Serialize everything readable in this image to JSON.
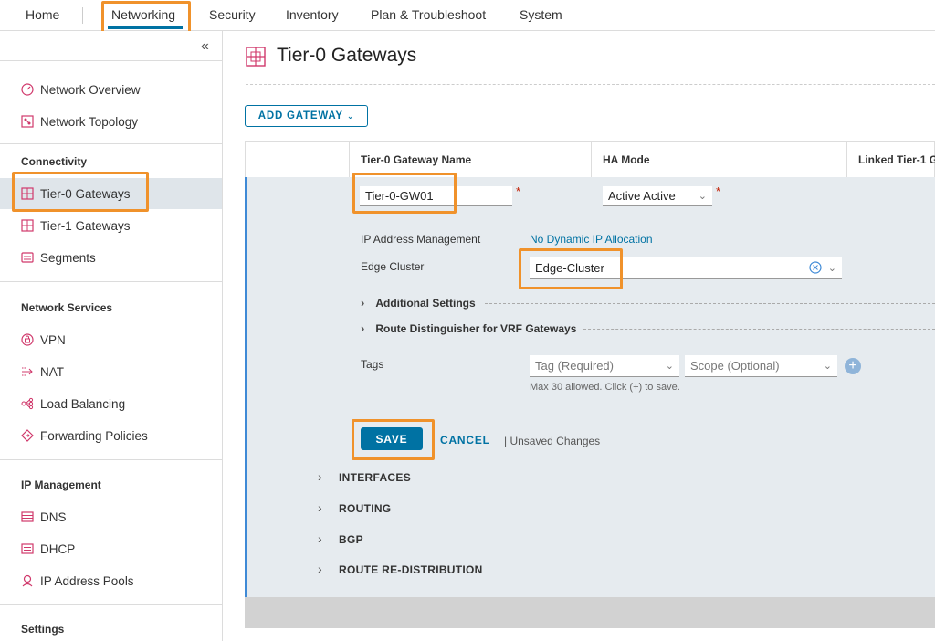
{
  "topnav": {
    "tabs": [
      {
        "label": "Home"
      },
      {
        "label": "Networking"
      },
      {
        "label": "Security"
      },
      {
        "label": "Inventory"
      },
      {
        "label": "Plan & Troubleshoot"
      },
      {
        "label": "System"
      }
    ],
    "active": "Networking"
  },
  "sidebar": {
    "collapse_glyph": "«",
    "top_items": [
      {
        "label": "Network Overview",
        "icon": "gauge-icon"
      },
      {
        "label": "Network Topology",
        "icon": "topology-icon"
      }
    ],
    "sections": [
      {
        "title": "Connectivity",
        "items": [
          {
            "label": "Tier-0 Gateways",
            "icon": "gateway-icon",
            "active": true
          },
          {
            "label": "Tier-1 Gateways",
            "icon": "gateway-icon"
          },
          {
            "label": "Segments",
            "icon": "segments-icon"
          }
        ]
      },
      {
        "title": "Network Services",
        "items": [
          {
            "label": "VPN",
            "icon": "vpn-icon"
          },
          {
            "label": "NAT",
            "icon": "nat-icon"
          },
          {
            "label": "Load Balancing",
            "icon": "load-balancing-icon"
          },
          {
            "label": "Forwarding Policies",
            "icon": "forwarding-icon"
          }
        ]
      },
      {
        "title": "IP Management",
        "items": [
          {
            "label": "DNS",
            "icon": "dns-icon"
          },
          {
            "label": "DHCP",
            "icon": "dhcp-icon"
          },
          {
            "label": "IP Address Pools",
            "icon": "ip-pool-icon"
          }
        ]
      },
      {
        "title": "Settings",
        "items": []
      }
    ]
  },
  "main": {
    "title": "Tier-0 Gateways",
    "add_button": "ADD GATEWAY",
    "columns": [
      "Tier-0 Gateway Name",
      "HA Mode",
      "Linked Tier-1 G"
    ],
    "form": {
      "name_value": "Tier-0-GW01",
      "ha_mode_value": "Active Active",
      "required_mark": "*",
      "ipam_label": "IP Address Management",
      "ipam_value": "No Dynamic IP Allocation",
      "edge_cluster_label": "Edge Cluster",
      "edge_cluster_value": "Edge-Cluster",
      "additional_settings": "Additional Settings",
      "route_distinguisher": "Route Distinguisher for VRF Gateways",
      "tags_label": "Tags",
      "tag_placeholder": "Tag (Required)",
      "scope_placeholder": "Scope (Optional)",
      "tags_helper": "Max 30 allowed. Click (+) to save.",
      "save": "SAVE",
      "cancel": "CANCEL",
      "unsaved": "| Unsaved Changes"
    },
    "subsections": [
      "INTERFACES",
      "ROUTING",
      "BGP",
      "ROUTE RE-DISTRIBUTION"
    ]
  },
  "colors": {
    "accent": "#0072a3",
    "highlight": "#f0922b",
    "active_border": "#3f8ad6",
    "icon_pink": "#d0386b"
  }
}
